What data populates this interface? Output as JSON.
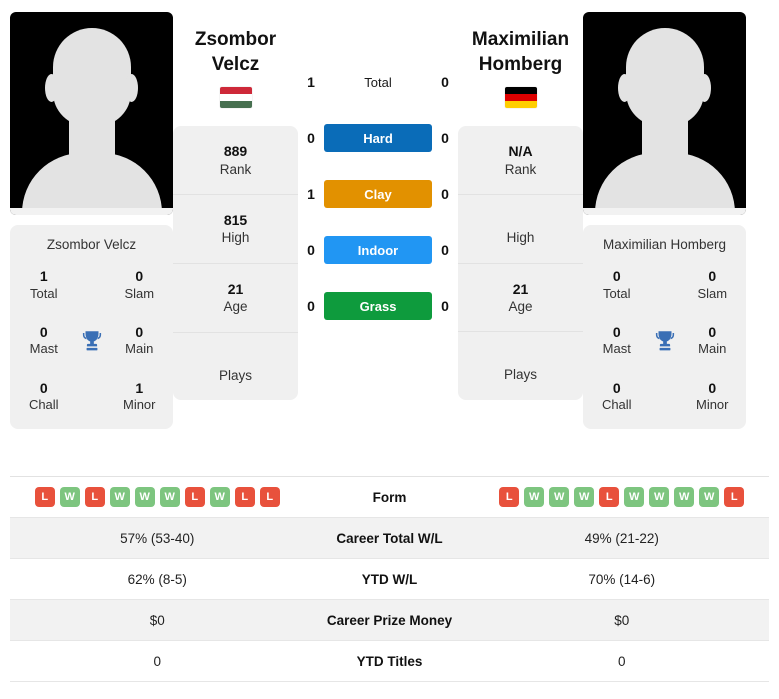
{
  "players": {
    "left": {
      "first_name": "Zsombor",
      "last_name": "Velcz",
      "full_name": "Zsombor Velcz",
      "flag_name": "hungary-flag",
      "flag_colors": [
        "#CE2939",
        "#FFFFFF",
        "#477050"
      ],
      "rank": "889",
      "rank_label": "Rank",
      "high": "815",
      "high_label": "High",
      "age": "21",
      "age_label": "Age",
      "plays": "",
      "plays_label": "Plays",
      "titles": [
        {
          "value": "1",
          "label": "Total"
        },
        {
          "value": "0",
          "label": "Slam"
        },
        {
          "value": "0",
          "label": "Mast"
        },
        {
          "value": "0",
          "label": "Main"
        },
        {
          "value": "0",
          "label": "Chall"
        },
        {
          "value": "1",
          "label": "Minor"
        }
      ],
      "form": [
        "L",
        "W",
        "L",
        "W",
        "W",
        "W",
        "L",
        "W",
        "L",
        "L"
      ],
      "career_total_wl": "57% (53-40)",
      "ytd_wl": "62% (8-5)",
      "career_prize_money": "$0",
      "ytd_titles": "0"
    },
    "right": {
      "first_name": "Maximilian",
      "last_name": "Homberg",
      "full_name": "Maximilian Homberg",
      "flag_name": "germany-flag",
      "flag_colors": [
        "#000000",
        "#DD0000",
        "#FFCE00"
      ],
      "rank": "N/A",
      "rank_label": "Rank",
      "high": "",
      "high_label": "High",
      "age": "21",
      "age_label": "Age",
      "plays": "",
      "plays_label": "Plays",
      "titles": [
        {
          "value": "0",
          "label": "Total"
        },
        {
          "value": "0",
          "label": "Slam"
        },
        {
          "value": "0",
          "label": "Mast"
        },
        {
          "value": "0",
          "label": "Main"
        },
        {
          "value": "0",
          "label": "Chall"
        },
        {
          "value": "0",
          "label": "Minor"
        }
      ],
      "form": [
        "L",
        "W",
        "W",
        "W",
        "L",
        "W",
        "W",
        "W",
        "W",
        "L"
      ],
      "career_total_wl": "49% (21-22)",
      "ytd_wl": "70% (14-6)",
      "career_prize_money": "$0",
      "ytd_titles": "0"
    }
  },
  "surfaces": [
    {
      "label": "Total",
      "left": "1",
      "right": "0",
      "color": "transparent",
      "plain": true
    },
    {
      "label": "Hard",
      "left": "0",
      "right": "0",
      "color": "#0A6CB8",
      "plain": false
    },
    {
      "label": "Clay",
      "left": "1",
      "right": "0",
      "color": "#E29100",
      "plain": false
    },
    {
      "label": "Indoor",
      "left": "0",
      "right": "0",
      "color": "#2196F3",
      "plain": false
    },
    {
      "label": "Grass",
      "left": "0",
      "right": "0",
      "color": "#0E9B3D",
      "plain": false
    }
  ],
  "table_rows": [
    {
      "label": "Form",
      "key": "form",
      "type": "form"
    },
    {
      "label": "Career Total W/L",
      "key": "career_total_wl",
      "type": "text"
    },
    {
      "label": "YTD W/L",
      "key": "ytd_wl",
      "type": "text"
    },
    {
      "label": "Career Prize Money",
      "key": "career_prize_money",
      "type": "text"
    },
    {
      "label": "YTD Titles",
      "key": "ytd_titles",
      "type": "text"
    }
  ],
  "form_colors": {
    "W": "#7DC57F",
    "L": "#E8513C"
  },
  "trophy_icon": {
    "name": "trophy-icon",
    "color": "#3A6FB5"
  }
}
